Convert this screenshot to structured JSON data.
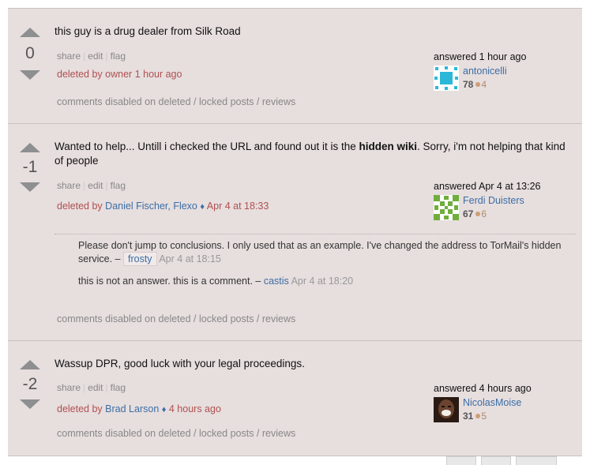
{
  "answers": [
    {
      "score": "0",
      "text": "this guy is a drug dealer from Silk Road",
      "menu": {
        "share": "share",
        "edit": "edit",
        "flag": "flag"
      },
      "deleted_prefix": "deleted by",
      "deleted_by": "owner 1 hour ago",
      "comments_disabled": "comments disabled on deleted / locked posts / reviews",
      "user": {
        "action": "answered 1 hour ago",
        "name": "antonicelli",
        "rep": "78",
        "bronze": "4"
      }
    },
    {
      "score": "-1",
      "text_before": "Wanted to help... Untill i checked the URL and found out it is the ",
      "text_bold": "hidden wiki",
      "text_after": ". Sorry, i'm not helping that kind of people",
      "menu": {
        "share": "share",
        "edit": "edit",
        "flag": "flag"
      },
      "deleted_prefix": "deleted by",
      "deleted_users": "Daniel Fischer, Flexo",
      "deleted_date": "Apr 4 at 18:33",
      "comments": [
        {
          "text": "Please don't jump to conclusions. I only used that as an example. I've changed the address to TorMail's hidden service. –",
          "user": "frosty",
          "date": "Apr 4 at 18:15"
        },
        {
          "text": "this is not an answer. this is a comment. –",
          "user": "castis",
          "date": "Apr 4 at 18:20"
        }
      ],
      "comments_disabled": "comments disabled on deleted / locked posts / reviews",
      "user": {
        "action": "answered Apr 4 at 13:26",
        "name": "Ferdi Duisters",
        "rep": "67",
        "bronze": "6"
      }
    },
    {
      "score": "-2",
      "text": "Wassup DPR, good luck with your legal proceedings.",
      "menu": {
        "share": "share",
        "edit": "edit",
        "flag": "flag"
      },
      "deleted_prefix": "deleted by",
      "deleted_users": "Brad Larson",
      "deleted_date": "4 hours ago",
      "comments_disabled": "comments disabled on deleted / locked posts / reviews",
      "user": {
        "action": "answered 4 hours ago",
        "name": "NicolasMoise",
        "rep": "31",
        "bronze": "5"
      }
    }
  ],
  "colors": {
    "background": "#e7dede",
    "link": "#3b6ea5",
    "deleted": "#b05050",
    "muted": "#888888",
    "bronze": "#cd9e74",
    "vote_arrow": "#8d8f90"
  }
}
